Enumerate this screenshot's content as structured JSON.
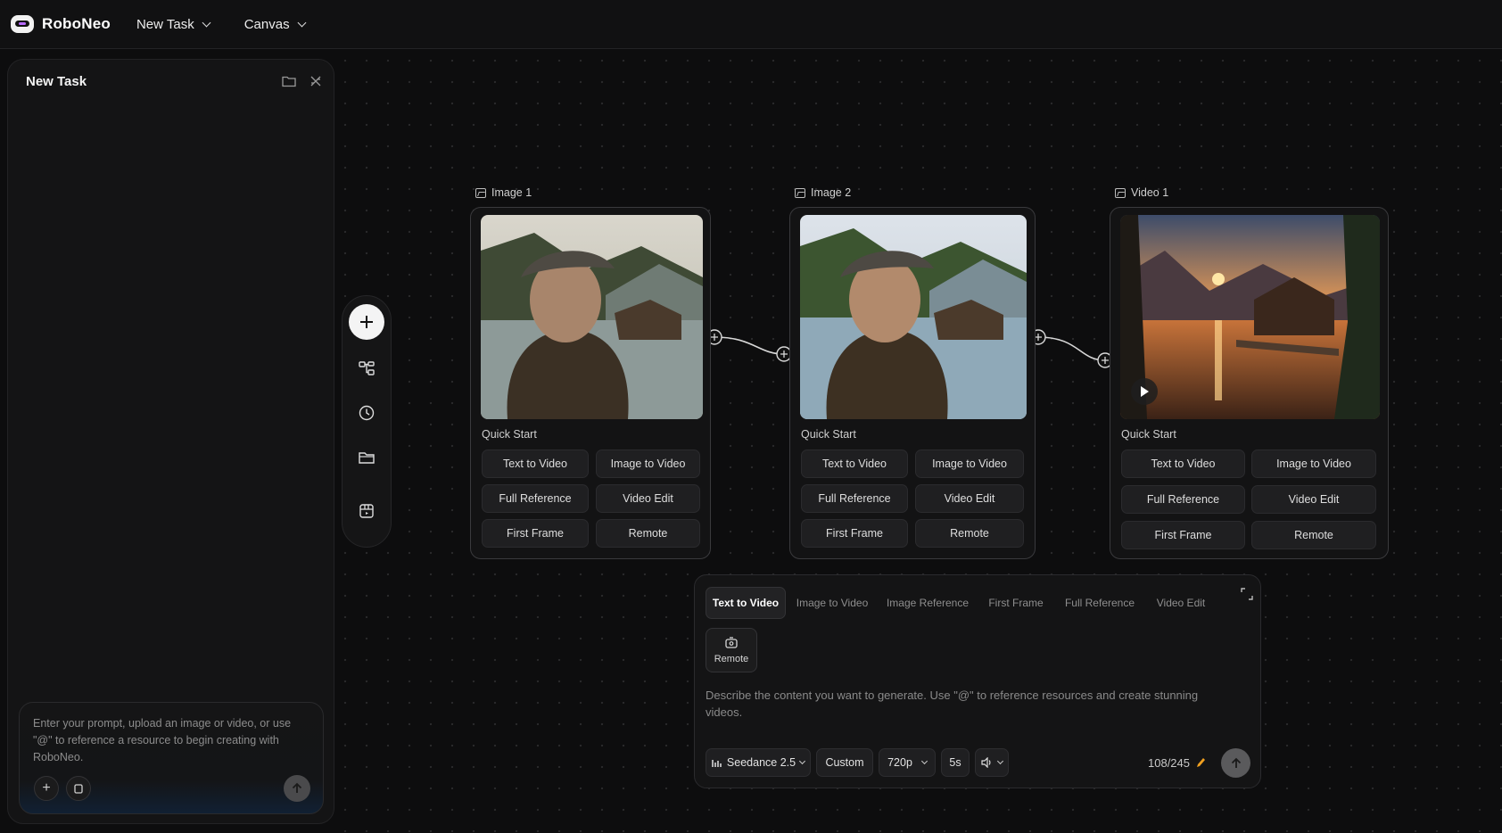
{
  "app": {
    "name": "RoboNeo"
  },
  "topbar": {
    "menus": [
      "New Task",
      "Canvas"
    ]
  },
  "left_panel": {
    "title": "New Task",
    "prompt_placeholder": "Enter your prompt, upload an image or video, or use \"@\" to reference a resource to begin creating with RoboNeo."
  },
  "toolbar": {
    "icons": [
      "plus-icon",
      "workflow-icon",
      "history-icon",
      "folder-icon",
      "calendar-icon"
    ]
  },
  "nodes": [
    {
      "label": "Image 1",
      "type": "image",
      "quick_start": "Quick Start",
      "buttons": [
        "Text to Video",
        "Image to Video",
        "Full Reference",
        "Video Edit",
        "First Frame",
        "Remote"
      ]
    },
    {
      "label": "Image 2",
      "type": "image",
      "quick_start": "Quick Start",
      "buttons": [
        "Text to Video",
        "Image to Video",
        "Full Reference",
        "Video Edit",
        "First Frame",
        "Remote"
      ]
    },
    {
      "label": "Video 1",
      "type": "video",
      "quick_start": "Quick Start",
      "buttons": [
        "Text to Video",
        "Image to Video",
        "Full Reference",
        "Video Edit",
        "First Frame",
        "Remote"
      ]
    }
  ],
  "generation": {
    "tabs": [
      "Text to Video",
      "Image to Video",
      "Image Reference",
      "First Frame",
      "Full Reference",
      "Video Edit"
    ],
    "active_tab": "Text to Video",
    "remote_label": "Remote",
    "description": "Describe the content you want to generate. Use \"@\" to reference resources and create stunning videos.",
    "model": "Seedance 2.5",
    "mode": "Custom",
    "resolution": "720p",
    "duration": "5s",
    "counter": "108/245"
  },
  "colors": {
    "background": "#0d0d0e",
    "panel": "#141415",
    "accent_pencil": "#f0a020"
  }
}
